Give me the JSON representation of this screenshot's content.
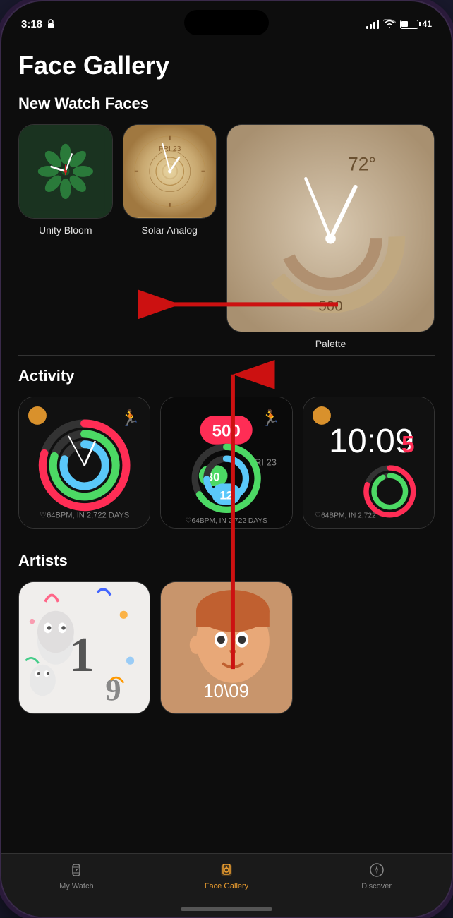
{
  "statusBar": {
    "time": "3:18",
    "battery": "41",
    "batteryIcon": "battery-icon"
  },
  "pageTitle": "Face Gallery",
  "sections": {
    "newWatchFaces": {
      "label": "New Watch Faces",
      "faces": [
        {
          "id": "unity-bloom",
          "label": "Unity Bloom"
        },
        {
          "id": "solar-analog",
          "label": "Solar Analog"
        },
        {
          "id": "palette",
          "label": "Palette"
        }
      ]
    },
    "activity": {
      "label": "Activity",
      "faces": [
        {
          "id": "activity-1",
          "label": ""
        },
        {
          "id": "activity-2",
          "label": ""
        },
        {
          "id": "activity-3",
          "label": ""
        }
      ]
    },
    "artists": {
      "label": "Artists",
      "faces": [
        {
          "id": "artists-1",
          "label": ""
        },
        {
          "id": "artists-2",
          "label": ""
        }
      ]
    }
  },
  "tabBar": {
    "items": [
      {
        "id": "my-watch",
        "label": "My Watch",
        "active": false
      },
      {
        "id": "face-gallery",
        "label": "Face Gallery",
        "active": true
      },
      {
        "id": "discover",
        "label": "Discover",
        "active": false
      }
    ]
  },
  "activityText": "64BPM, IN 2,722 DAYS",
  "activityText2": "64BPM, IN 2,722 DAYS",
  "activityText3": "64BPM, IN 2,722",
  "activityTime": "10:09"
}
